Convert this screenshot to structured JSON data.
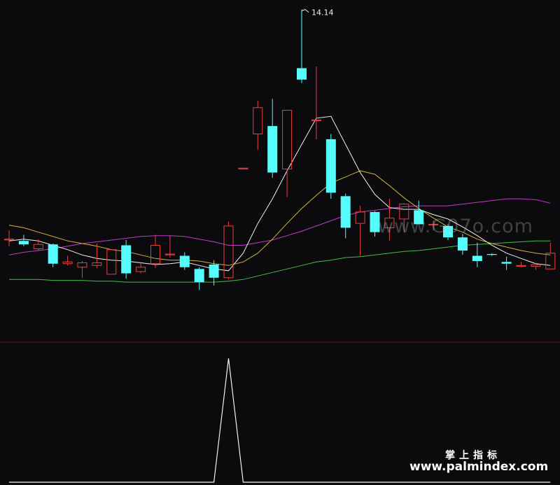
{
  "chart_data": [
    {
      "type": "candlestick",
      "title": "",
      "ylim": [
        10.4,
        14.2
      ],
      "grid": false,
      "colors": {
        "up": "#e8413e",
        "down": "#54fcfc",
        "ma_white": "#f2f2f2",
        "ma_yellow": "#d7b13e",
        "ma_magenta": "#c13bc9",
        "ma_green": "#3fbf47",
        "separator": "#7a1010",
        "background": "#0b0b0d"
      },
      "annotations": [
        {
          "text": "14.14",
          "bar": 20,
          "value": 14.14
        }
      ],
      "candles": [
        {
          "o": 11.52,
          "h": 11.62,
          "l": 11.44,
          "c": 11.52
        },
        {
          "o": 11.5,
          "h": 11.57,
          "l": 11.44,
          "c": 11.46
        },
        {
          "o": 11.41,
          "h": 11.52,
          "l": 11.39,
          "c": 11.46
        },
        {
          "o": 11.46,
          "h": 11.47,
          "l": 11.2,
          "c": 11.24
        },
        {
          "o": 11.24,
          "h": 11.33,
          "l": 11.22,
          "c": 11.26
        },
        {
          "o": 11.2,
          "h": 11.27,
          "l": 11.08,
          "c": 11.25
        },
        {
          "o": 11.22,
          "h": 11.47,
          "l": 11.19,
          "c": 11.25
        },
        {
          "o": 11.12,
          "h": 11.24,
          "l": 11.12,
          "c": 11.4
        },
        {
          "o": 11.45,
          "h": 11.51,
          "l": 11.07,
          "c": 11.13
        },
        {
          "o": 11.15,
          "h": 11.26,
          "l": 11.13,
          "c": 11.2
        },
        {
          "o": 11.24,
          "h": 11.57,
          "l": 11.19,
          "c": 11.45
        },
        {
          "o": 11.35,
          "h": 11.56,
          "l": 11.31,
          "c": 11.35
        },
        {
          "o": 11.33,
          "h": 11.37,
          "l": 11.17,
          "c": 11.2
        },
        {
          "o": 11.18,
          "h": 11.2,
          "l": 10.94,
          "c": 11.03
        },
        {
          "o": 11.23,
          "h": 11.28,
          "l": 10.99,
          "c": 11.08
        },
        {
          "o": 11.08,
          "h": 11.72,
          "l": 11.06,
          "c": 11.67
        },
        {
          "o": 12.33,
          "h": 12.33,
          "l": 12.33,
          "c": 12.33
        },
        {
          "o": 12.72,
          "h": 13.1,
          "l": 12.54,
          "c": 13.02
        },
        {
          "o": 12.81,
          "h": 13.12,
          "l": 12.22,
          "c": 12.28
        },
        {
          "o": 12.32,
          "h": 12.28,
          "l": 12.0,
          "c": 12.99
        },
        {
          "o": 13.47,
          "h": 14.14,
          "l": 13.3,
          "c": 13.34
        },
        {
          "o": 12.88,
          "h": 13.49,
          "l": 12.66,
          "c": 12.88
        },
        {
          "o": 12.66,
          "h": 12.72,
          "l": 11.98,
          "c": 12.05
        },
        {
          "o": 12.01,
          "h": 12.04,
          "l": 11.53,
          "c": 11.65
        },
        {
          "o": 11.7,
          "h": 11.9,
          "l": 11.33,
          "c": 11.83
        },
        {
          "o": 11.83,
          "h": 11.84,
          "l": 11.55,
          "c": 11.6
        },
        {
          "o": 11.65,
          "h": 11.98,
          "l": 11.5,
          "c": 11.76
        },
        {
          "o": 11.75,
          "h": 11.93,
          "l": 11.6,
          "c": 11.92
        },
        {
          "o": 11.85,
          "h": 11.96,
          "l": 11.69,
          "c": 11.69
        },
        {
          "o": 11.69,
          "h": 11.73,
          "l": 11.62,
          "c": 11.69
        },
        {
          "o": 11.67,
          "h": 11.69,
          "l": 11.51,
          "c": 11.54
        },
        {
          "o": 11.54,
          "h": 11.58,
          "l": 11.34,
          "c": 11.39
        },
        {
          "o": 11.33,
          "h": 11.48,
          "l": 11.2,
          "c": 11.27
        },
        {
          "o": 11.35,
          "h": 11.36,
          "l": 11.33,
          "c": 11.34
        },
        {
          "o": 11.26,
          "h": 11.32,
          "l": 11.17,
          "c": 11.24
        },
        {
          "o": 11.22,
          "h": 11.26,
          "l": 11.2,
          "c": 11.22
        },
        {
          "o": 11.21,
          "h": 11.25,
          "l": 11.17,
          "c": 11.23
        },
        {
          "o": 11.18,
          "h": 11.48,
          "l": 11.19,
          "c": 11.36
        }
      ],
      "ma_white": [
        11.5,
        11.52,
        11.5,
        11.45,
        11.4,
        11.34,
        11.3,
        11.28,
        11.27,
        11.25,
        11.23,
        11.24,
        11.26,
        11.22,
        11.18,
        11.16,
        11.36,
        11.7,
        11.98,
        12.3,
        12.6,
        12.9,
        12.92,
        12.6,
        12.28,
        12.03,
        11.88,
        11.86,
        11.86,
        11.8,
        11.75,
        11.66,
        11.56,
        11.45,
        11.36,
        11.3,
        11.24,
        11.22
      ],
      "ma_yellow": [
        11.68,
        11.65,
        11.6,
        11.55,
        11.5,
        11.47,
        11.44,
        11.4,
        11.38,
        11.34,
        11.3,
        11.28,
        11.28,
        11.27,
        11.24,
        11.22,
        11.26,
        11.36,
        11.52,
        11.7,
        11.87,
        12.02,
        12.16,
        12.23,
        12.3,
        12.26,
        12.13,
        11.99,
        11.87,
        11.76,
        11.66,
        11.6,
        11.52,
        11.47,
        11.43,
        11.39,
        11.36,
        11.34
      ],
      "ma_magenta": [
        11.34,
        11.37,
        11.39,
        11.41,
        11.44,
        11.47,
        11.49,
        11.51,
        11.53,
        11.55,
        11.56,
        11.56,
        11.55,
        11.52,
        11.49,
        11.45,
        11.45,
        11.48,
        11.51,
        11.56,
        11.61,
        11.67,
        11.73,
        11.79,
        11.83,
        11.85,
        11.87,
        11.89,
        11.9,
        11.9,
        11.9,
        11.92,
        11.94,
        11.96,
        11.98,
        11.98,
        11.97,
        11.93
      ],
      "ma_green": [
        11.06,
        11.06,
        11.06,
        11.05,
        11.05,
        11.05,
        11.04,
        11.04,
        11.03,
        11.03,
        11.03,
        11.03,
        11.03,
        11.03,
        11.03,
        11.04,
        11.06,
        11.1,
        11.14,
        11.18,
        11.22,
        11.26,
        11.28,
        11.31,
        11.32,
        11.34,
        11.36,
        11.38,
        11.39,
        11.41,
        11.43,
        11.45,
        11.46,
        11.47,
        11.48,
        11.49,
        11.5,
        11.5
      ]
    },
    {
      "type": "line",
      "title": "",
      "grid": false,
      "ylim": [
        0,
        1
      ],
      "series": [
        {
          "values": [
            0,
            0,
            0,
            0,
            0,
            0,
            0,
            0,
            0,
            0,
            0,
            0,
            0,
            0,
            0,
            1,
            0,
            0,
            0,
            0,
            0,
            0,
            0,
            0,
            0,
            0,
            0,
            0,
            0,
            0,
            0,
            0,
            0,
            0,
            0,
            0,
            0,
            0
          ]
        }
      ]
    }
  ],
  "watermark": {
    "middle": "www.G07o.com",
    "brand_cn": "掌上指标",
    "brand_url": "www.palmindex.com"
  }
}
